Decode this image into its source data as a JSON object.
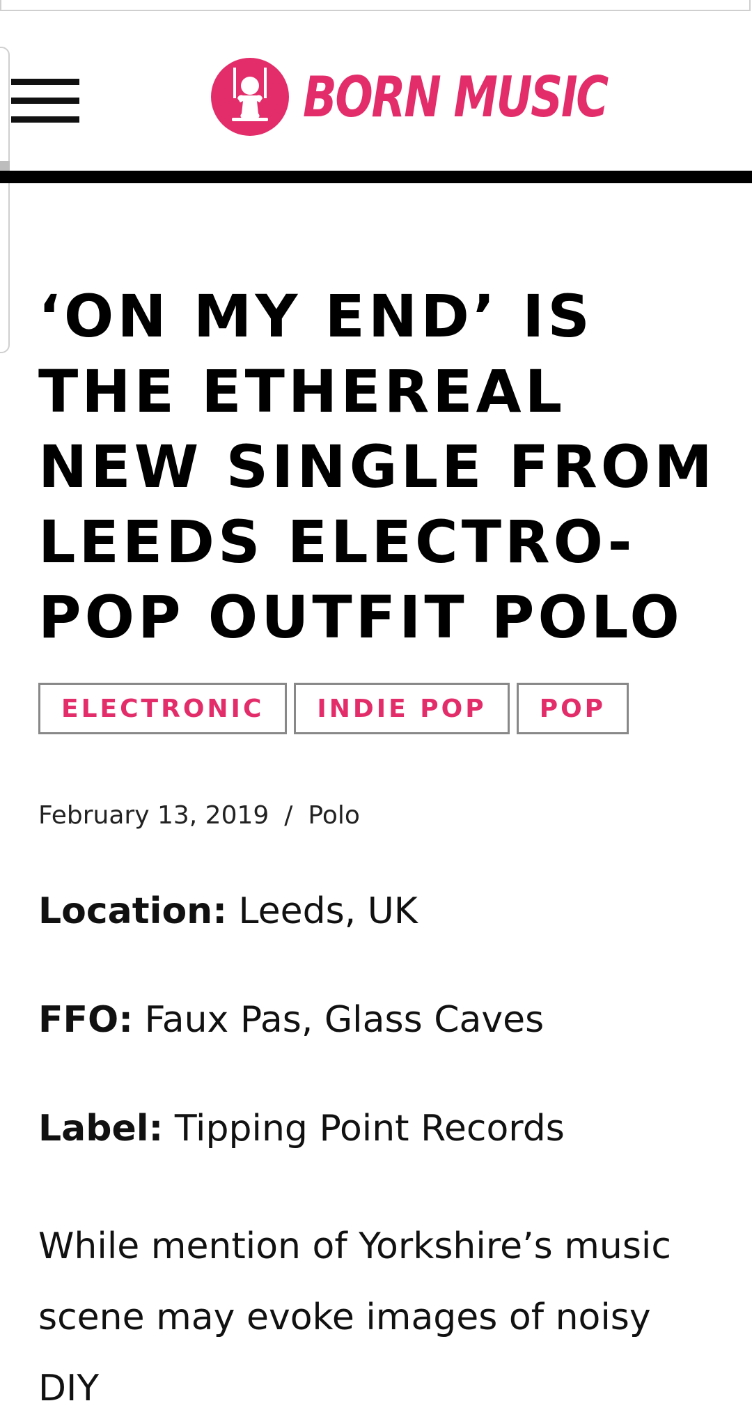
{
  "header": {
    "menu_icon": "hamburger-menu-icon",
    "logo_text": "BORN MUSIC",
    "brand_color": "#e32d6b"
  },
  "article": {
    "title": "‘On My End’ is the ethereal new single from Leeds electro-pop outfit Polo",
    "tags": [
      "Electronic",
      "Indie Pop",
      "Pop"
    ],
    "date": "February 13, 2019",
    "separator": "/",
    "author": "Polo",
    "location_label": "Location:",
    "location_value": "Leeds, UK",
    "ffo_label": "FFO:",
    "ffo_value": "Faux Pas, Glass Caves",
    "label_label": "Label:",
    "label_value": "Tipping Point Records",
    "body_start": "While mention of Yorkshire’s music scene may evoke images of noisy DIY"
  }
}
